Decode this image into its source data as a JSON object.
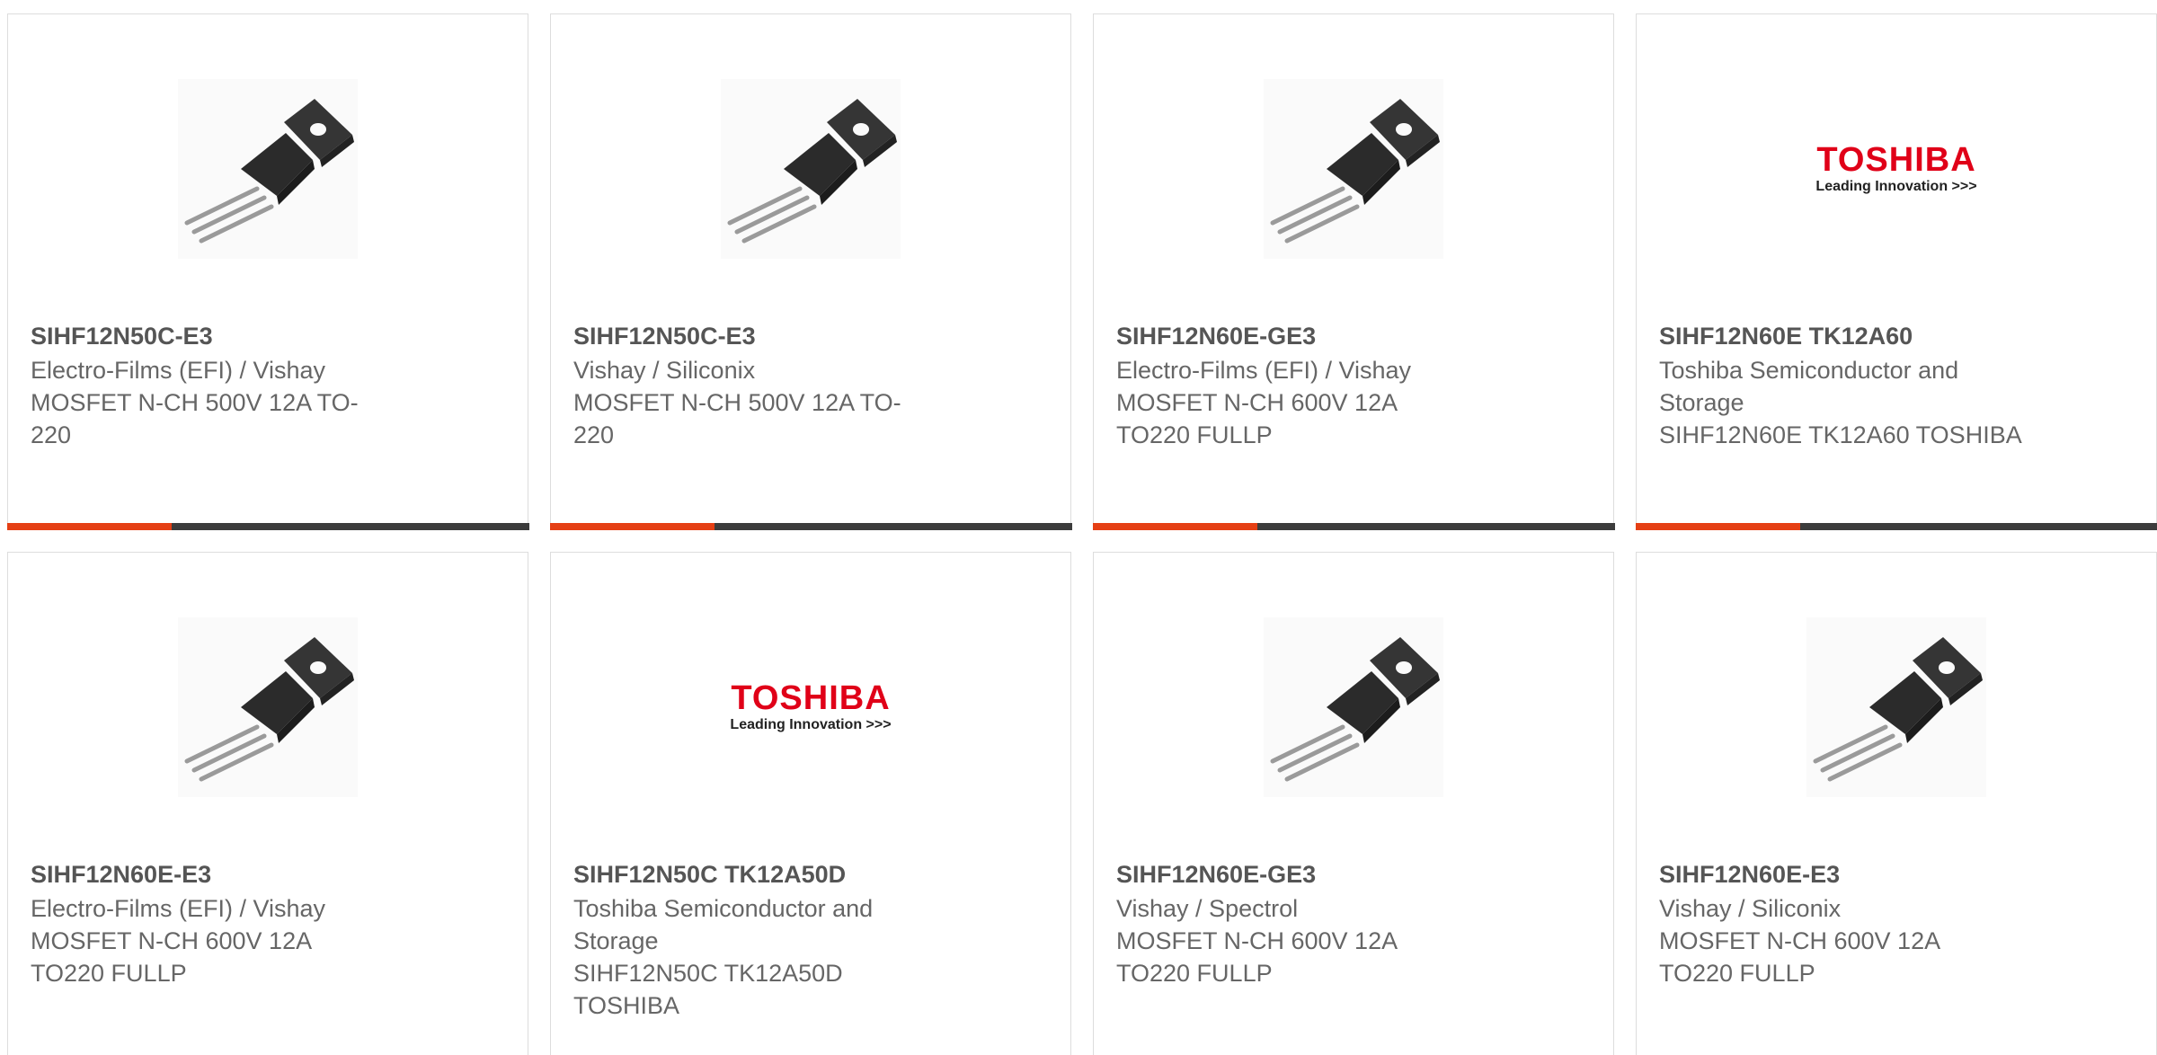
{
  "products": [
    {
      "part": "SIHF12N50C-E3",
      "maker": [
        "Electro-Films (EFI) / Vishay"
      ],
      "desc": [
        "MOSFET N-CH 500V 12A TO-",
        "220"
      ],
      "image": "transistor"
    },
    {
      "part": "SIHF12N50C-E3",
      "maker": [
        "Vishay / Siliconix"
      ],
      "desc": [
        "MOSFET N-CH 500V 12A TO-",
        "220"
      ],
      "image": "transistor"
    },
    {
      "part": "SIHF12N60E-GE3",
      "maker": [
        "Electro-Films (EFI) / Vishay"
      ],
      "desc": [
        "MOSFET N-CH 600V 12A",
        "TO220 FULLP"
      ],
      "image": "transistor"
    },
    {
      "part": "SIHF12N60E TK12A60",
      "maker": [
        "Toshiba Semiconductor and",
        "Storage"
      ],
      "desc": [
        "SIHF12N60E TK12A60 TOSHIBA"
      ],
      "image": "toshiba-logo"
    },
    {
      "part": "SIHF12N60E-E3",
      "maker": [
        "Electro-Films (EFI) / Vishay"
      ],
      "desc": [
        "MOSFET N-CH 600V 12A",
        "TO220 FULLP"
      ],
      "image": "transistor"
    },
    {
      "part": "SIHF12N50C TK12A50D",
      "maker": [
        "Toshiba Semiconductor and",
        "Storage"
      ],
      "desc": [
        "SIHF12N50C TK12A50D",
        "TOSHIBA"
      ],
      "image": "toshiba-logo"
    },
    {
      "part": "SIHF12N60E-GE3",
      "maker": [
        "Vishay / Spectrol"
      ],
      "desc": [
        "MOSFET N-CH 600V 12A",
        "TO220 FULLP"
      ],
      "image": "transistor"
    },
    {
      "part": "SIHF12N60E-E3",
      "maker": [
        "Vishay / Siliconix"
      ],
      "desc": [
        "MOSFET N-CH 600V 12A",
        "TO220 FULLP"
      ],
      "image": "transistor"
    }
  ],
  "logo": {
    "brand": "TOSHIBA",
    "tagline": "Leading Innovation >>>"
  },
  "colors": {
    "accent": "#e53f14",
    "bar": "#3c3c3c",
    "border": "#dddddd",
    "text": "#666666",
    "logo_red": "#e00018"
  }
}
